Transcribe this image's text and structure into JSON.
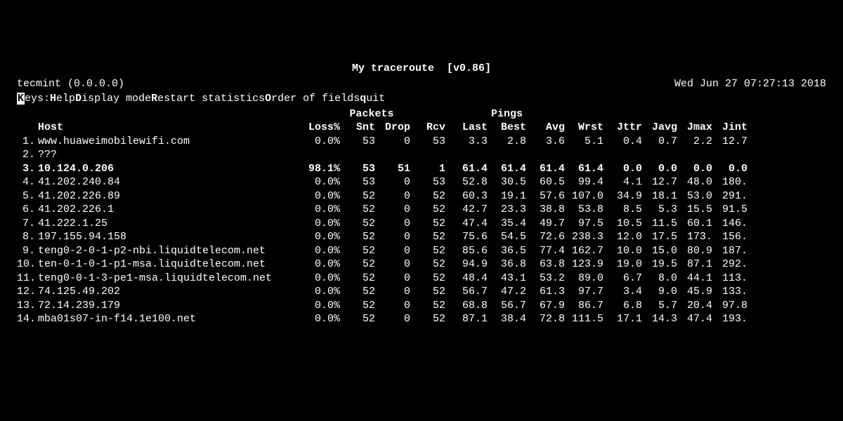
{
  "title": "My traceroute",
  "version": "[v0.86]",
  "hostline": "tecmint (0.0.0.0)",
  "datetime": "Wed Jun 27 07:27:13 2018",
  "keys": {
    "label": "Keys:",
    "items": [
      {
        "hot": "H",
        "rest": "elp"
      },
      {
        "hot": "D",
        "rest": "isplay mode"
      },
      {
        "hot": "R",
        "rest": "estart statistics"
      },
      {
        "hot": "O",
        "rest": "rder of fields"
      },
      {
        "hot": "q",
        "rest": "uit"
      }
    ]
  },
  "section_headers": {
    "packets": "Packets",
    "pings": "Pings"
  },
  "columns": {
    "host": "Host",
    "loss": "Loss%",
    "snt": "Snt",
    "drop": "Drop",
    "rcv": "Rcv",
    "last": "Last",
    "best": "Best",
    "avg": "Avg",
    "wrst": "Wrst",
    "jttr": "Jttr",
    "javg": "Javg",
    "jmax": "Jmax",
    "jint": "Jint"
  },
  "rows": [
    {
      "n": "1.",
      "host": "www.huaweimobilewifi.com",
      "loss": "0.0%",
      "snt": "53",
      "drop": "0",
      "rcv": "53",
      "last": "3.3",
      "best": "2.8",
      "avg": "3.6",
      "wrst": "5.1",
      "jttr": "0.4",
      "javg": "0.7",
      "jmax": "2.2",
      "jint": "12.7",
      "bold": false
    },
    {
      "n": "2.",
      "host": "???",
      "loss": "",
      "snt": "",
      "drop": "",
      "rcv": "",
      "last": "",
      "best": "",
      "avg": "",
      "wrst": "",
      "jttr": "",
      "javg": "",
      "jmax": "",
      "jint": "",
      "bold": false
    },
    {
      "n": "3.",
      "host": "10.124.0.206",
      "loss": "98.1%",
      "snt": "53",
      "drop": "51",
      "rcv": "1",
      "last": "61.4",
      "best": "61.4",
      "avg": "61.4",
      "wrst": "61.4",
      "jttr": "0.0",
      "javg": "0.0",
      "jmax": "0.0",
      "jint": "0.0",
      "bold": true
    },
    {
      "n": "4.",
      "host": "41.202.240.84",
      "loss": "0.0%",
      "snt": "53",
      "drop": "0",
      "rcv": "53",
      "last": "52.8",
      "best": "30.5",
      "avg": "60.5",
      "wrst": "99.4",
      "jttr": "4.1",
      "javg": "12.7",
      "jmax": "48.0",
      "jint": "180.",
      "bold": false
    },
    {
      "n": "5.",
      "host": "41.202.226.89",
      "loss": "0.0%",
      "snt": "52",
      "drop": "0",
      "rcv": "52",
      "last": "60.3",
      "best": "19.1",
      "avg": "57.6",
      "wrst": "107.0",
      "jttr": "34.9",
      "javg": "18.1",
      "jmax": "53.0",
      "jint": "291.",
      "bold": false
    },
    {
      "n": "6.",
      "host": "41.202.226.1",
      "loss": "0.0%",
      "snt": "52",
      "drop": "0",
      "rcv": "52",
      "last": "42.7",
      "best": "23.3",
      "avg": "38.8",
      "wrst": "53.8",
      "jttr": "8.5",
      "javg": "5.3",
      "jmax": "15.5",
      "jint": "91.5",
      "bold": false
    },
    {
      "n": "7.",
      "host": "41.222.1.25",
      "loss": "0.0%",
      "snt": "52",
      "drop": "0",
      "rcv": "52",
      "last": "47.4",
      "best": "35.4",
      "avg": "49.7",
      "wrst": "97.5",
      "jttr": "10.5",
      "javg": "11.5",
      "jmax": "60.1",
      "jint": "146.",
      "bold": false
    },
    {
      "n": "8.",
      "host": "197.155.94.158",
      "loss": "0.0%",
      "snt": "52",
      "drop": "0",
      "rcv": "52",
      "last": "75.6",
      "best": "54.5",
      "avg": "72.6",
      "wrst": "238.3",
      "jttr": "12.0",
      "javg": "17.5",
      "jmax": "173.",
      "jint": "156.",
      "bold": false
    },
    {
      "n": "9.",
      "host": "teng0-2-0-1-p2-nbi.liquidtelecom.net",
      "loss": "0.0%",
      "snt": "52",
      "drop": "0",
      "rcv": "52",
      "last": "85.6",
      "best": "36.5",
      "avg": "77.4",
      "wrst": "162.7",
      "jttr": "10.0",
      "javg": "15.0",
      "jmax": "80.9",
      "jint": "187.",
      "bold": false
    },
    {
      "n": "10.",
      "host": "ten-0-1-0-1-p1-msa.liquidtelecom.net",
      "loss": "0.0%",
      "snt": "52",
      "drop": "0",
      "rcv": "52",
      "last": "94.9",
      "best": "36.8",
      "avg": "63.8",
      "wrst": "123.9",
      "jttr": "19.0",
      "javg": "19.5",
      "jmax": "87.1",
      "jint": "292.",
      "bold": false
    },
    {
      "n": "11.",
      "host": "teng0-0-1-3-pe1-msa.liquidtelecom.net",
      "loss": "0.0%",
      "snt": "52",
      "drop": "0",
      "rcv": "52",
      "last": "48.4",
      "best": "43.1",
      "avg": "53.2",
      "wrst": "89.0",
      "jttr": "6.7",
      "javg": "8.0",
      "jmax": "44.1",
      "jint": "113.",
      "bold": false
    },
    {
      "n": "12.",
      "host": "74.125.49.202",
      "loss": "0.0%",
      "snt": "52",
      "drop": "0",
      "rcv": "52",
      "last": "56.7",
      "best": "47.2",
      "avg": "61.3",
      "wrst": "97.7",
      "jttr": "3.4",
      "javg": "9.0",
      "jmax": "45.9",
      "jint": "133.",
      "bold": false
    },
    {
      "n": "13.",
      "host": "72.14.239.179",
      "loss": "0.0%",
      "snt": "52",
      "drop": "0",
      "rcv": "52",
      "last": "68.8",
      "best": "56.7",
      "avg": "67.9",
      "wrst": "86.7",
      "jttr": "6.8",
      "javg": "5.7",
      "jmax": "20.4",
      "jint": "97.8",
      "bold": false
    },
    {
      "n": "14.",
      "host": "mba01s07-in-f14.1e100.net",
      "loss": "0.0%",
      "snt": "52",
      "drop": "0",
      "rcv": "52",
      "last": "87.1",
      "best": "38.4",
      "avg": "72.8",
      "wrst": "111.5",
      "jttr": "17.1",
      "javg": "14.3",
      "jmax": "47.4",
      "jint": "193.",
      "bold": false
    }
  ]
}
